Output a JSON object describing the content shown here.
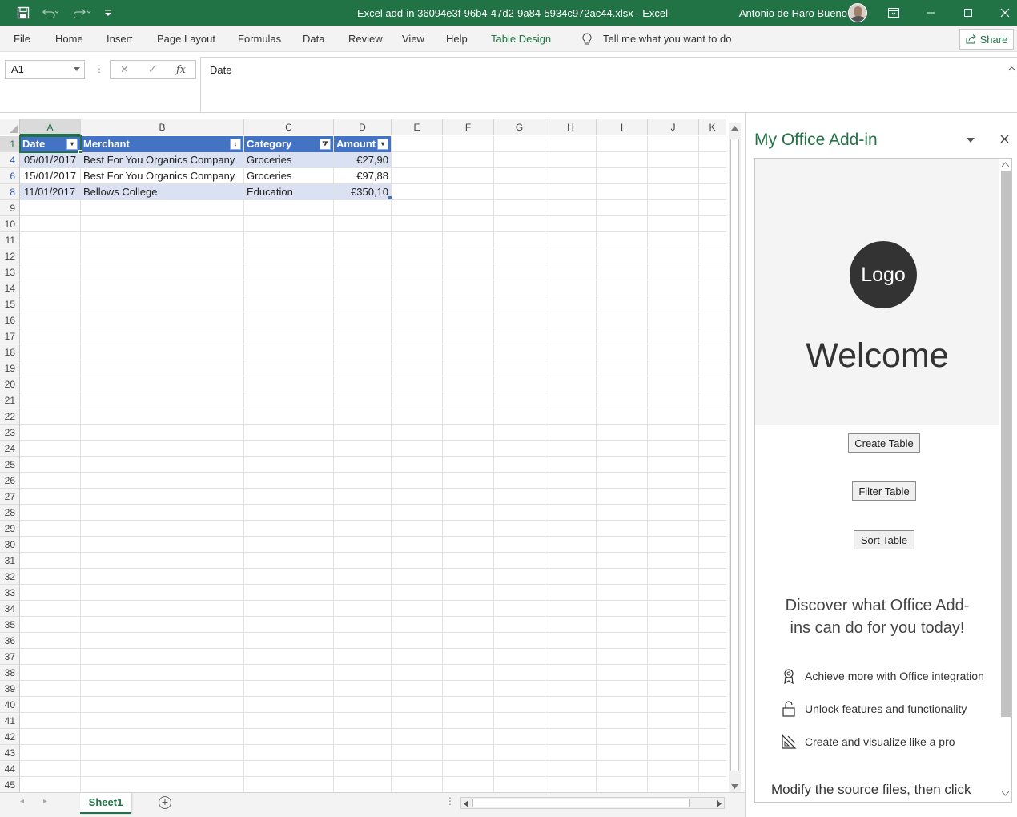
{
  "title_bar": {
    "file_title": "Excel add-in 36094e3f-96b4-47d2-9a84-5934c972ac44.xlsx  -  Excel",
    "user_name": "Antonio de Haro Bueno",
    "accent": "#217346"
  },
  "ribbon": {
    "tabs": [
      "File",
      "Home",
      "Insert",
      "Page Layout",
      "Formulas",
      "Data",
      "Review",
      "View",
      "Help",
      "Table Design"
    ],
    "tell_me": "Tell me what you want to do",
    "share": "Share"
  },
  "formula_bar": {
    "name_box": "A1",
    "fx": "fx",
    "formula": "Date"
  },
  "grid": {
    "columns": [
      "A",
      "B",
      "C",
      "D",
      "E",
      "F",
      "G",
      "H",
      "I",
      "J",
      "K"
    ],
    "row_numbers": [
      "1",
      "4",
      "6",
      "8",
      "9",
      "10",
      "11",
      "12",
      "13",
      "14",
      "15",
      "16",
      "17",
      "18",
      "19",
      "20",
      "21",
      "22",
      "23",
      "24",
      "25",
      "26",
      "27",
      "28",
      "29",
      "30",
      "31",
      "32",
      "33",
      "34",
      "35",
      "36",
      "37",
      "38",
      "39",
      "40",
      "41",
      "42",
      "43",
      "44",
      "45"
    ],
    "table_headers": [
      "Date",
      "Merchant",
      "Category",
      "Amount"
    ],
    "table_rows": [
      [
        "05/01/2017",
        "Best For You Organics Company",
        "Groceries",
        "€27,90"
      ],
      [
        "15/01/2017",
        "Best For You Organics Company",
        "Groceries",
        "€97,88"
      ],
      [
        "11/01/2017",
        "Bellows College",
        "Education",
        "€350,10"
      ]
    ]
  },
  "sheet_tabs": {
    "active": "Sheet1"
  },
  "task_pane": {
    "title": "My Office Add-in",
    "logo": "Logo",
    "welcome": "Welcome",
    "buttons": [
      "Create Table",
      "Filter Table",
      "Sort Table"
    ],
    "discover": "Discover what Office Add-ins can do for you today!",
    "features": [
      {
        "icon": "ribbon-icon",
        "text": "Achieve more with Office integration"
      },
      {
        "icon": "unlock-icon",
        "text": "Unlock features and functionality"
      },
      {
        "icon": "design-icon",
        "text": "Create and visualize like a pro"
      }
    ],
    "modify": "Modify the source files, then click"
  }
}
